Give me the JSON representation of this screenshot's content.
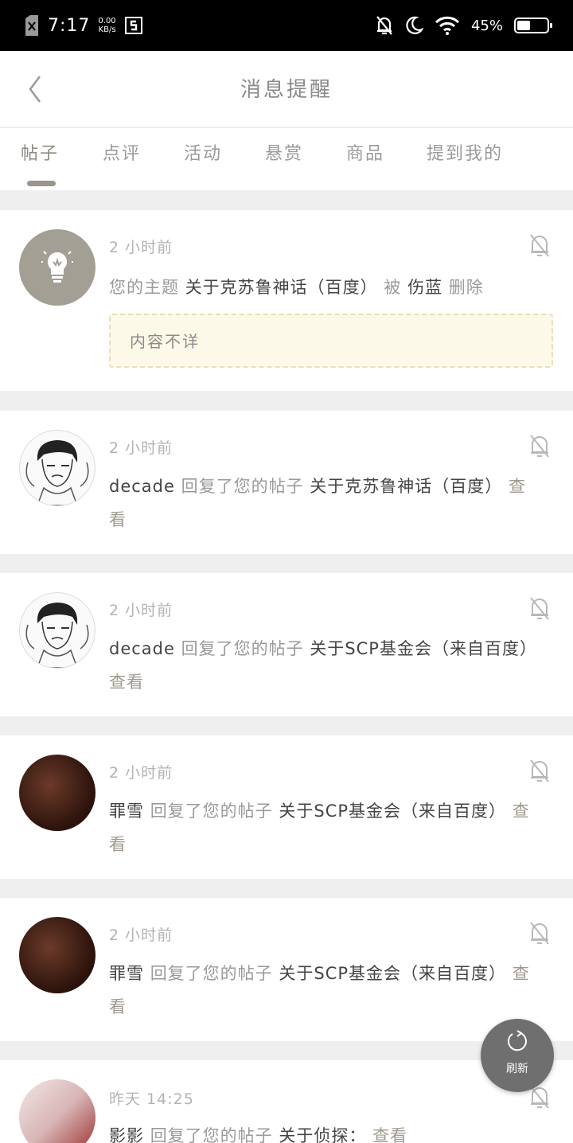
{
  "status_bar": {
    "time": "7:17",
    "speed_value": "0.00",
    "speed_unit": "KB/s",
    "battery_percent": "45%",
    "battery_level": 0.45
  },
  "header": {
    "title": "消息提醒"
  },
  "tabs": [
    {
      "label": "帖子",
      "active": true
    },
    {
      "label": "点评"
    },
    {
      "label": "活动"
    },
    {
      "label": "悬赏"
    },
    {
      "label": "商品"
    },
    {
      "label": "提到我的"
    }
  ],
  "notifications": [
    {
      "time": "2 小时前",
      "parts": [
        "您的主题",
        "关于克苏鲁神话（百度）",
        "被",
        "伤蓝",
        "删除"
      ],
      "content": "内容不详"
    },
    {
      "time": "2 小时前",
      "user": "decade",
      "action": "回复了您的帖子",
      "topic": "关于克苏鲁神话（百度）",
      "link": "查看"
    },
    {
      "time": "2 小时前",
      "user": "decade",
      "action": "回复了您的帖子",
      "topic": "关于SCP基金会（来自百度）",
      "link": "查看"
    },
    {
      "time": "2 小时前",
      "user": "罪雪",
      "action": "回复了您的帖子",
      "topic": "关于SCP基金会（来自百度）",
      "link": "查看"
    },
    {
      "time": "2 小时前",
      "user": "罪雪",
      "action": "回复了您的帖子",
      "topic": "关于SCP基金会（来自百度）",
      "link": "查看"
    },
    {
      "time": "昨天 14:25",
      "user": "影影",
      "action": "回复了您的帖子",
      "topic": "关于侦探：",
      "link": "查看"
    }
  ],
  "fab": {
    "label": "刷新"
  }
}
